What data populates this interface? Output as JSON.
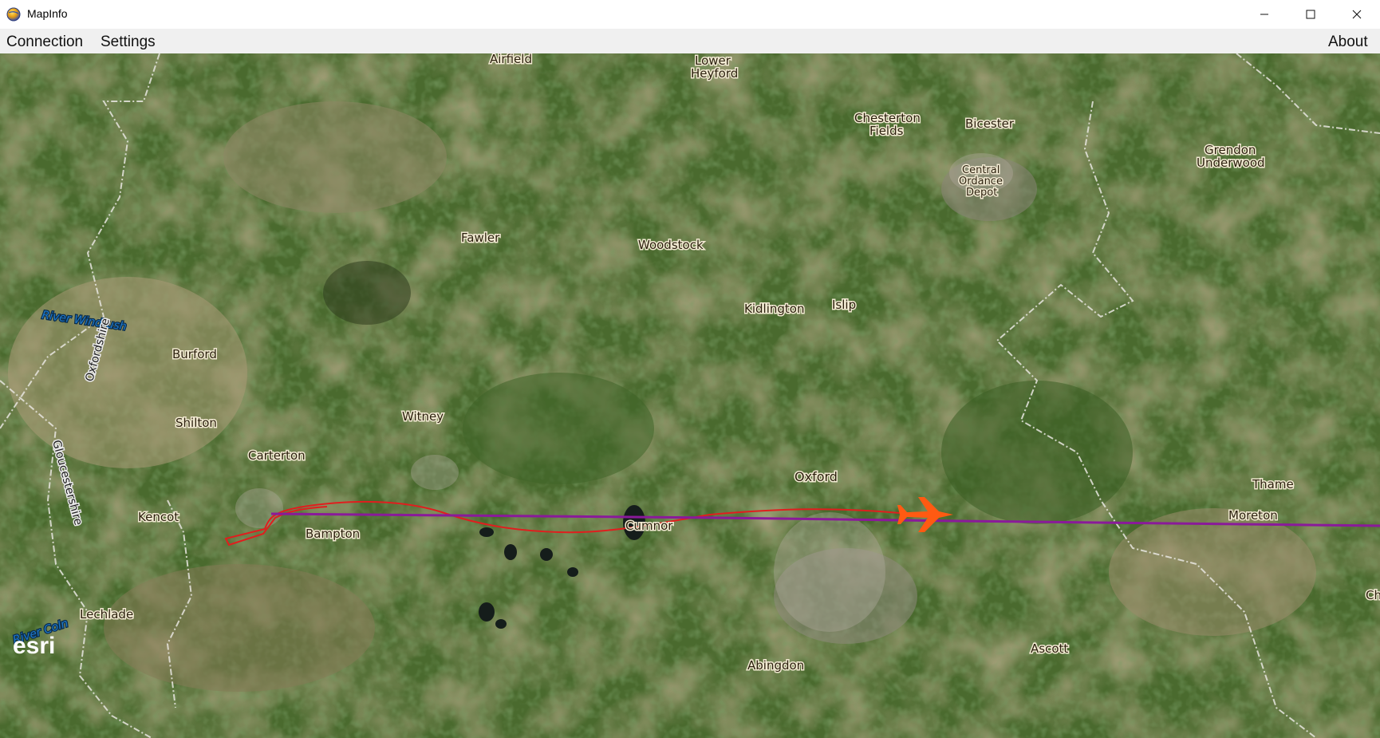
{
  "window": {
    "title": "MapInfo"
  },
  "menu": {
    "connection": "Connection",
    "settings": "Settings",
    "about": "About"
  },
  "map": {
    "places": {
      "airfield": "Airfield",
      "lower": "Lower",
      "heyford": "Heyford",
      "chesterton": "Chesterton",
      "fields": "Fields",
      "bicester": "Bicester",
      "grendon": "Grendon",
      "underwood": "Underwood",
      "central": "Central",
      "ordance": "Ordance",
      "depot": "Depot",
      "fawler": "Fawler",
      "woodstock": "Woodstock",
      "kidlington": "Kidlington",
      "islip": "Islip",
      "burford": "Burford",
      "shilton": "Shilton",
      "witney": "Witney",
      "carterton": "Carterton",
      "oxford": "Oxford",
      "thame": "Thame",
      "kencot": "Kencot",
      "bampton": "Bampton",
      "cumnor": "Cumnor",
      "moreton": "Moreton",
      "lechlade": "Lechlade",
      "ascott": "Ascott",
      "abingdon": "Abingdon",
      "ch": "Ch"
    },
    "rivers": {
      "windrush": "River Windrush",
      "coln": "River Coln"
    },
    "boundaries": {
      "oxfordshire": "Oxfordshire",
      "gloucestershire": "Gloucestershire"
    },
    "attribution": "esri",
    "colors": {
      "flight_path": "#e01e1e",
      "route_line": "#8a1a9a",
      "aircraft": "#ff5a12"
    }
  }
}
